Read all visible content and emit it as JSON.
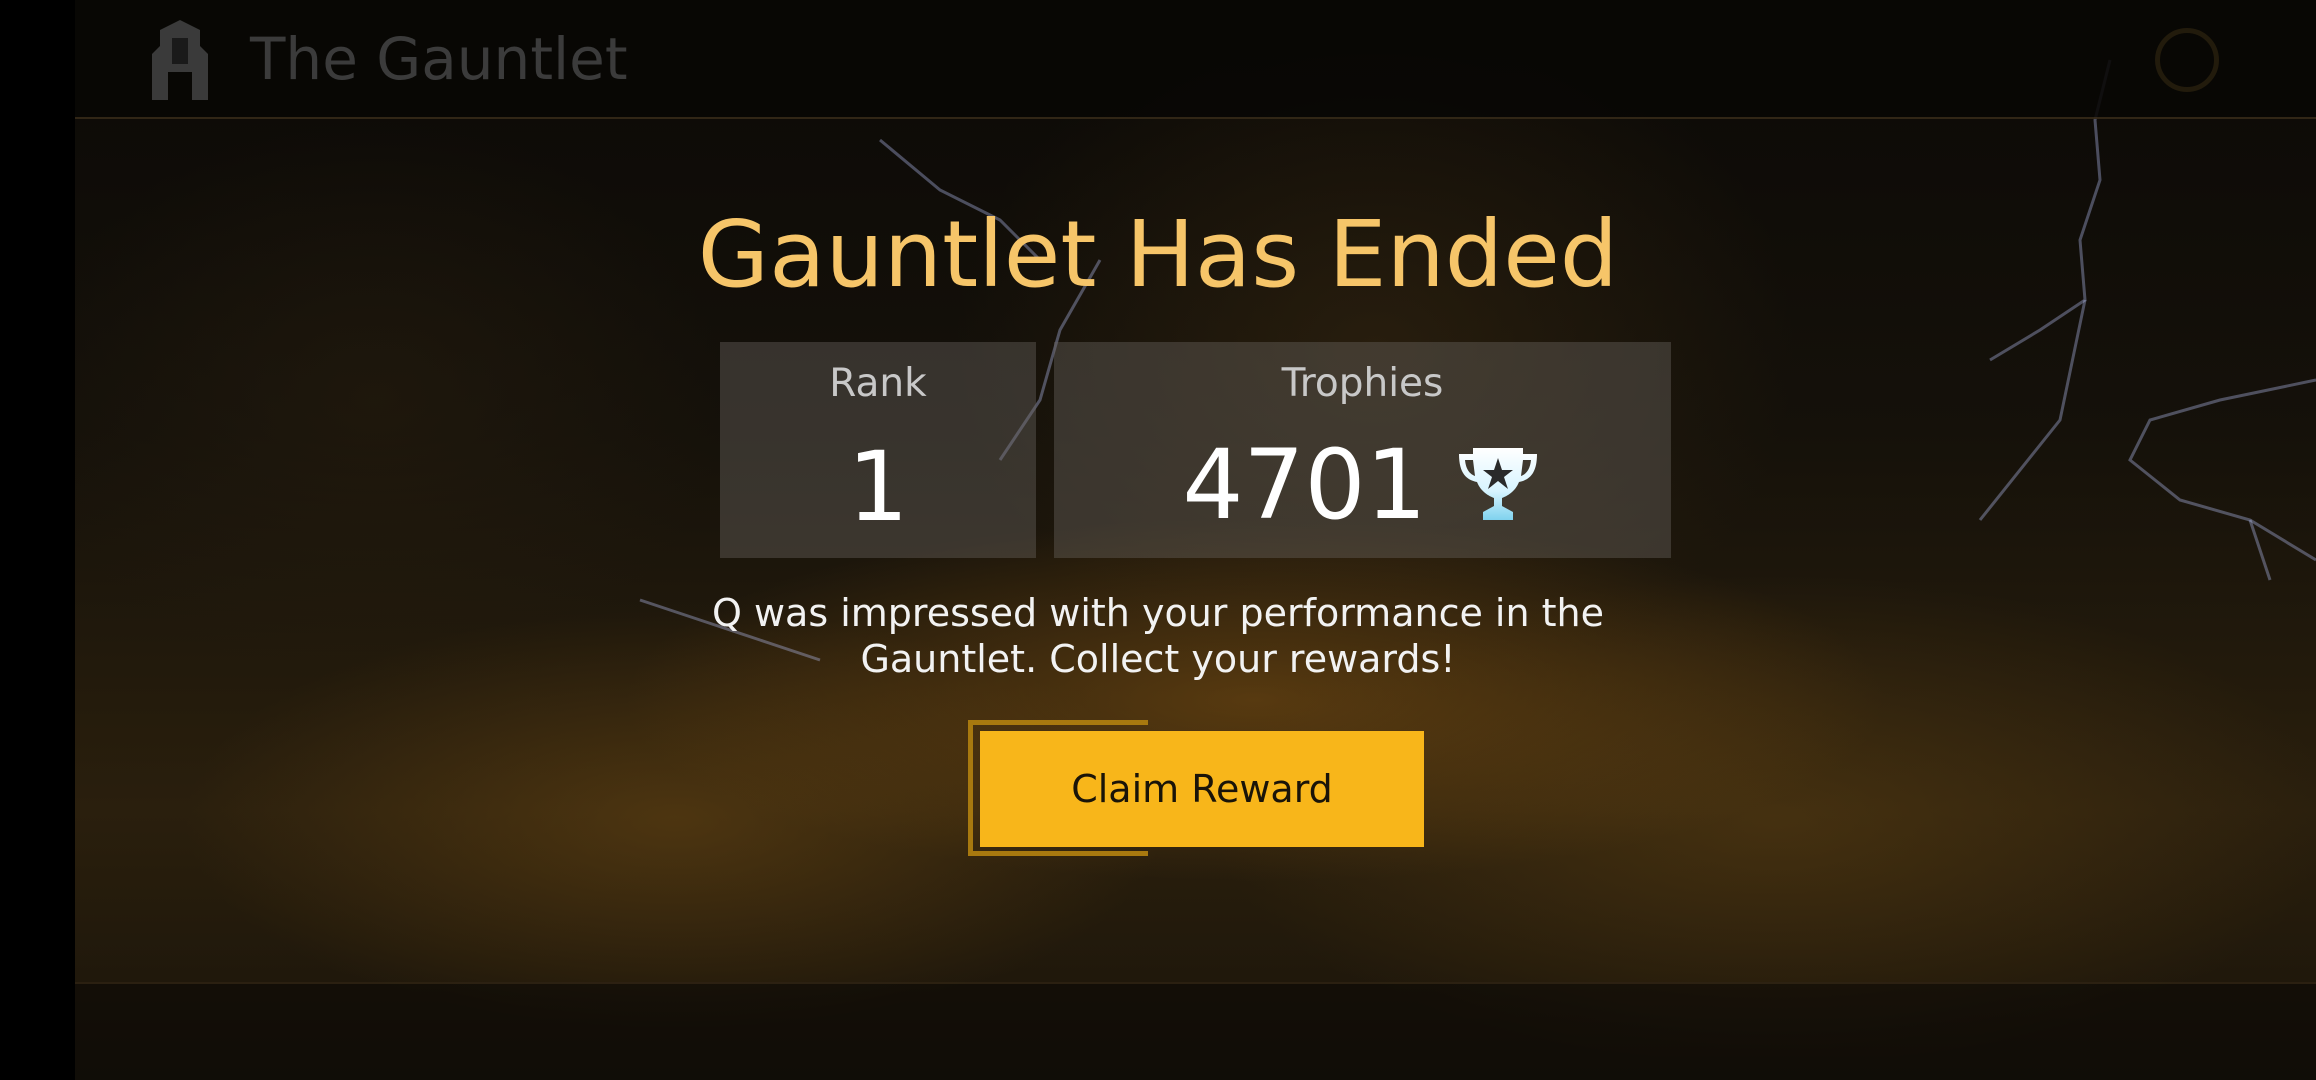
{
  "header": {
    "title": "The Gauntlet",
    "icon": "gauntlet-emblem-icon",
    "right_icon": "settings-gear-icon"
  },
  "main": {
    "headline": "Gauntlet Has Ended",
    "rank": {
      "label": "Rank",
      "value": "1"
    },
    "trophies": {
      "label": "Trophies",
      "value": "4701",
      "icon": "trophy-icon"
    },
    "message_lines": [
      "Q was impressed with your performance in the",
      "Gauntlet. Collect your rewards!"
    ],
    "claim_button_label": "Claim Reward"
  },
  "colors": {
    "headline": "#f6c569",
    "button": "#f8b61a",
    "button_frame": "#a8790f",
    "trophy": "#bfefff"
  }
}
